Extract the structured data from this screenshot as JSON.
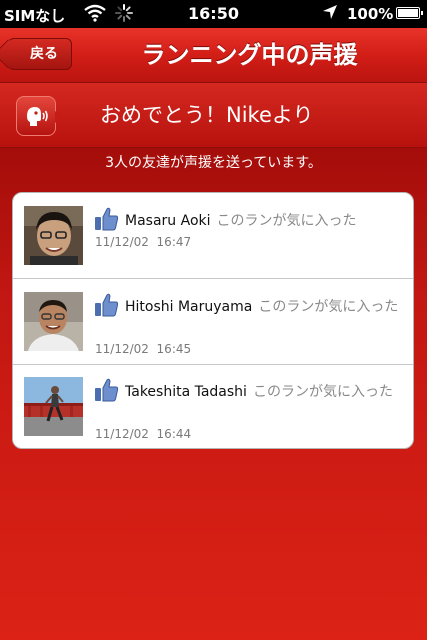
{
  "status_bar": {
    "carrier": "SIMなし",
    "time": "16:50",
    "battery": "100%"
  },
  "nav": {
    "back_label": "戻る",
    "title": "ランニング中の声援"
  },
  "banner": {
    "text": "おめでとう！Nikeより",
    "icon": "cheer-icon"
  },
  "subtitle": "3人の友達が声援を送っています。",
  "cheers": [
    {
      "name": "Masaru Aoki",
      "action": "このランが気に入った",
      "date": "11/12/02",
      "time": "16:47"
    },
    {
      "name": "Hitoshi Maruyama",
      "action": "このランが気に入った",
      "date": "11/12/02",
      "time": "16:45"
    },
    {
      "name": "Takeshita Tadashi",
      "action": "このランが気に入った",
      "date": "11/12/02",
      "time": "16:44"
    }
  ],
  "colors": {
    "accent": "#d21e17",
    "like_blue": "#4a6eb0"
  }
}
